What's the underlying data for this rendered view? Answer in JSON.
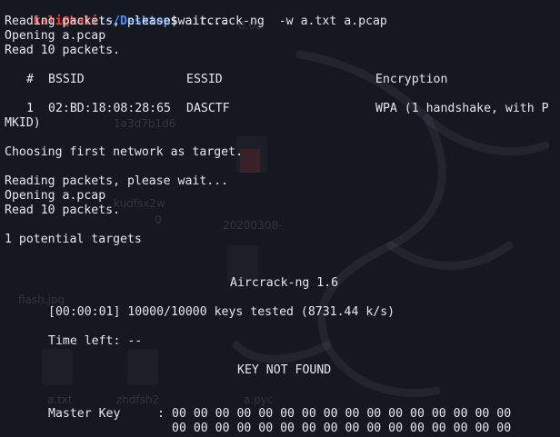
{
  "prompt": {
    "user_host": "kali@kali",
    "path": ":~/Desktop",
    "symbol": "$",
    "command": " aircrack-ng  -w a.txt a.pcap"
  },
  "output": {
    "reading1": "Reading packets, please wait...",
    "opening1": "Opening a.pcap",
    "read1": "Read 10 packets.",
    "table_header": {
      "hash": "#",
      "bssid": "BSSID",
      "essid": "ESSID",
      "encryption": "Encryption"
    },
    "table_row": {
      "index": "1",
      "bssid": "02:BD:18:08:28:65",
      "essid": "DASCTF",
      "encryption": "WPA (1 handshake, with P"
    },
    "table_row_wrap": "MKID)",
    "choosing": "Choosing first network as target.",
    "reading2": "Reading packets, please wait...",
    "opening2": "Opening a.pcap",
    "read2": "Read 10 packets.",
    "potential": "1 potential targets",
    "aircrack_title": "Aircrack-ng 1.6",
    "progress": "[00:00:01] 10000/10000 keys tested (8731.44 k/s)",
    "time_left": "Time left: --",
    "result": "KEY NOT FOUND",
    "master_key_label": "Master Key",
    "master_key_colon": ":",
    "master_key_line1": "00 00 00 00 00 00 00 00 00 00 00 00 00 00 00 00",
    "master_key_line2": "00 00 00 00 00 00 00 00 00 00 00 00 00 00 00 00"
  },
  "desktop_shadow_labels": {
    "l1": "0.02",
    "l2": "1a3d7b1d6",
    "l3": "20200308-",
    "l4": "0",
    "l5": "kudfsx2w",
    "l6": "flash.jpg",
    "l7": "a.txt",
    "l8": "zhdfsh2",
    "l9": "a.pyc"
  },
  "colors": {
    "background": "#141820",
    "text": "#e6e8ec",
    "prompt_user": "#ff3b3b",
    "prompt_path": "#4f8cff"
  }
}
